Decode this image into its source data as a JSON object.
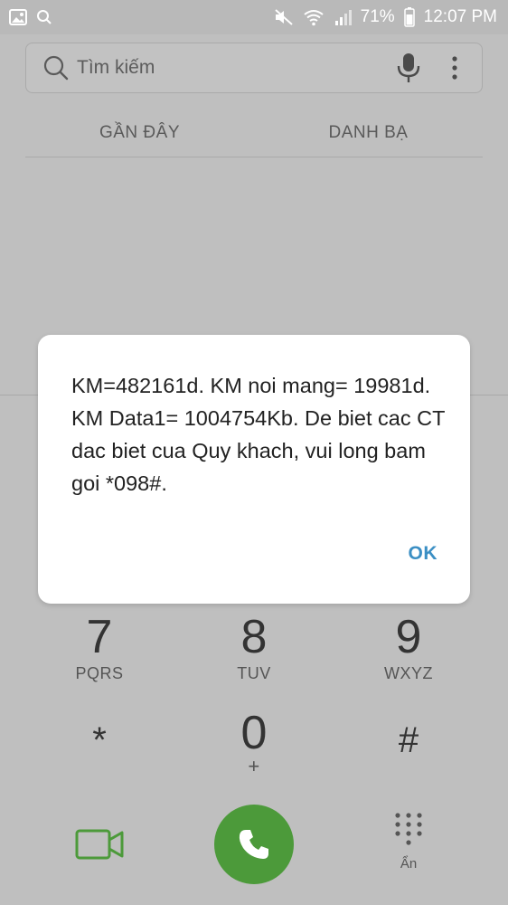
{
  "status_bar": {
    "battery_percent": "71%",
    "time": "12:07 PM"
  },
  "search": {
    "placeholder": "Tìm kiếm"
  },
  "tabs": [
    {
      "label": "GẦN ĐÂY"
    },
    {
      "label": "DANH BẠ"
    }
  ],
  "dialog": {
    "message": "KM=482161d. KM noi mang= 19981d. KM Data1= 1004754Kb. De biet cac CT dac biet cua Quy khach, vui long bam goi *098#.",
    "ok_label": "OK"
  },
  "keypad": {
    "keys": [
      {
        "digit": "7",
        "letters": "PQRS"
      },
      {
        "digit": "8",
        "letters": "TUV"
      },
      {
        "digit": "9",
        "letters": "WXYZ"
      },
      {
        "digit": "*",
        "letters": ""
      },
      {
        "digit": "0",
        "letters": "+"
      },
      {
        "digit": "#",
        "letters": ""
      }
    ]
  },
  "bottom_bar": {
    "hide_label": "Ẩn"
  },
  "colors": {
    "accent_ok": "#3b8fc4",
    "call_green": "#4c9a3a",
    "video_green": "#4c9a3a"
  }
}
